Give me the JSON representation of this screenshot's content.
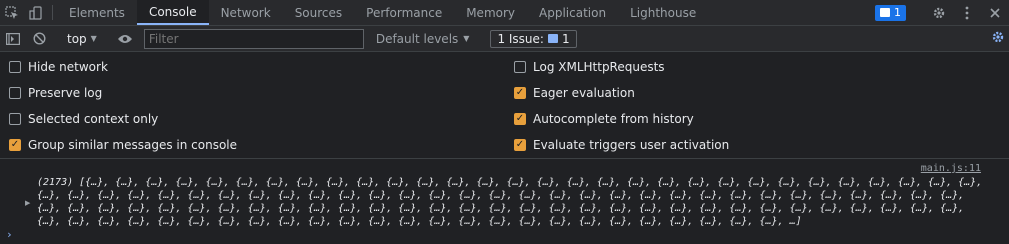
{
  "tabs": [
    {
      "label": "Elements",
      "active": false
    },
    {
      "label": "Console",
      "active": true
    },
    {
      "label": "Network",
      "active": false
    },
    {
      "label": "Sources",
      "active": false
    },
    {
      "label": "Performance",
      "active": false
    },
    {
      "label": "Memory",
      "active": false
    },
    {
      "label": "Application",
      "active": false
    },
    {
      "label": "Lighthouse",
      "active": false
    }
  ],
  "issue_badge_count": "1",
  "toolbar": {
    "context": "top",
    "filter_placeholder": "Filter",
    "levels": "Default levels",
    "issues_label": "1 Issue:",
    "issues_count": "1"
  },
  "settings": {
    "left": [
      {
        "label": "Hide network",
        "checked": false
      },
      {
        "label": "Preserve log",
        "checked": false
      },
      {
        "label": "Selected context only",
        "checked": false
      },
      {
        "label": "Group similar messages in console",
        "checked": true
      }
    ],
    "right": [
      {
        "label": "Log XMLHttpRequests",
        "checked": false
      },
      {
        "label": "Eager evaluation",
        "checked": true
      },
      {
        "label": "Autocomplete from history",
        "checked": true
      },
      {
        "label": "Evaluate triggers user activation",
        "checked": true
      }
    ]
  },
  "console": {
    "source_link": "main.js:11",
    "log_text": "(2173) [{…}, {…}, {…}, {…}, {…}, {…}, {…}, {…}, {…}, {…}, {…}, {…}, {…}, {…}, {…}, {…}, {…}, {…}, {…}, {…}, {…}, {…}, {…}, {…}, {…}, {…}, {…}, {…}, {…}, {…}, {…}, {…}, {…}, {…}, {…}, {…}, {…}, {…}, {…}, {…}, {…}, {…}, {…}, {…}, {…}, {…}, {…}, {…}, {…}, {…}, {…}, {…}, {…}, {…}, {…}, {…}, {…}, {…}, {…}, {…}, {…}, {…}, {…}, {…}, {…}, {…}, {…}, {…}, {…}, {…}, {…}, {…}, {…}, {…}, {…}, {…}, {…}, {…}, {…}, {…}, {…}, {…}, {…}, {…}, {…}, {…}, {…}, {…}, {…}, {…}, {…}, {…}, {…}, {…}, {…}, {…}, {…}, {…}, {…}, {…}, {…}, {…}, {…}, {…}, {…}, {…}, {…}, {…}, {…}, {…}, {…}, {…}, {…}, {…}, {…}, {…}, {…}, …]",
    "prompt": "›"
  },
  "colors": {
    "accent": "#8ab4f8",
    "checkbox_checked": "#e8a03c",
    "badge": "#1a73e8"
  },
  "icons": {
    "inspect": "inspect-element-icon",
    "device": "device-toolbar-icon",
    "sidebar": "sidebar-toggle-icon",
    "clear": "clear-console-icon",
    "eye": "live-expression-eye-icon",
    "gear": "gear-icon",
    "kebab": "more-options-icon",
    "close": "close-icon"
  }
}
